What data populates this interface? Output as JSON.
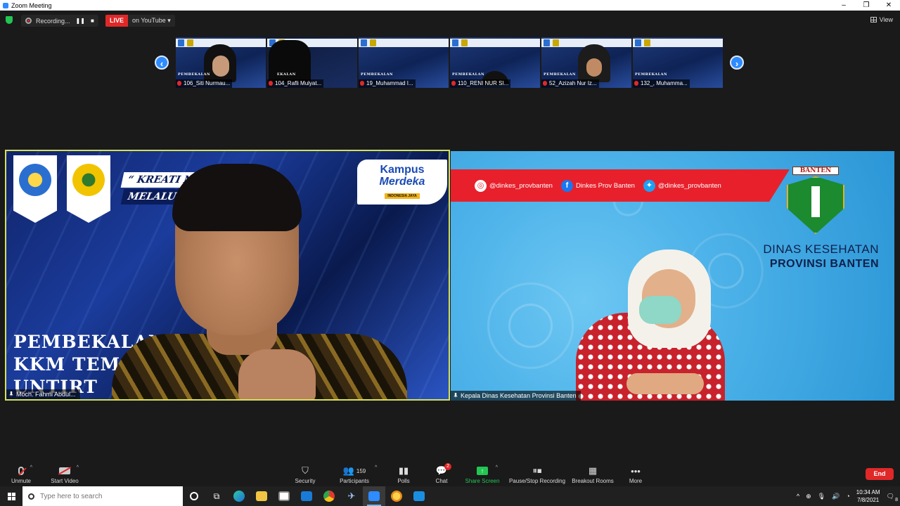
{
  "window": {
    "title": "Zoom Meeting"
  },
  "topbar": {
    "recording_label": "Recording...",
    "live_label": "LIVE",
    "stream_target": "on YouTube",
    "view_label": "View"
  },
  "thumbnails": [
    {
      "name": "106_Siti Nurmau...",
      "banner_word": "PEMBEKALAN"
    },
    {
      "name": "104_Rafli Mulyat...",
      "banner_word": "EKALAN"
    },
    {
      "name": "19_Muhammad I...",
      "banner_word": "PEMBEKALAN"
    },
    {
      "name": "110_RENI NUR SI...",
      "banner_word": "PEMBEKALAN"
    },
    {
      "name": "52_Azizah Nur Iz...",
      "banner_word": "PEMBEKALAN"
    },
    {
      "name": "132_, Muhamma...",
      "banner_word": "PEMBEKALAN"
    }
  ],
  "main_left": {
    "banner_line1": "“ KREATI          N DAERAH",
    "banner_line2": "MELALUI            KNOLOGI”",
    "kampus_line1": "Kampus",
    "kampus_line2": "Merdeka",
    "kampus_line3": "INDONESIA JAYA",
    "title_line1": "PEMBEKALAN",
    "title_line2": "KKM TEMATIK",
    "title_line3": "UNTIRT",
    "participant_name": "Moch. Fahmi Abdul..."
  },
  "main_right": {
    "instagram": "@dinkes_provbanten",
    "facebook": "Dinkes Prov Banten",
    "twitter": "@dinkes_provbanten",
    "logo_label": "BANTEN",
    "org_line1": "DINAS KESEHATAN",
    "org_line2": "PROVINSI BANTEN",
    "participant_name": "Kepala Dinas Kesehatan Provinsi Banten"
  },
  "toolbar": {
    "unmute": "Unmute",
    "start_video": "Start Video",
    "security": "Security",
    "participants": "Participants",
    "participants_count": "159",
    "polls": "Polls",
    "chat": "Chat",
    "chat_badge": "2",
    "share_screen": "Share Screen",
    "pause_recording": "Pause/Stop Recording",
    "breakout_rooms": "Breakout Rooms",
    "more": "More",
    "end": "End"
  },
  "taskbar": {
    "search_placeholder": "Type here to search",
    "time": "10:34 AM",
    "date": "7/8/2021",
    "notification_count": "8"
  }
}
